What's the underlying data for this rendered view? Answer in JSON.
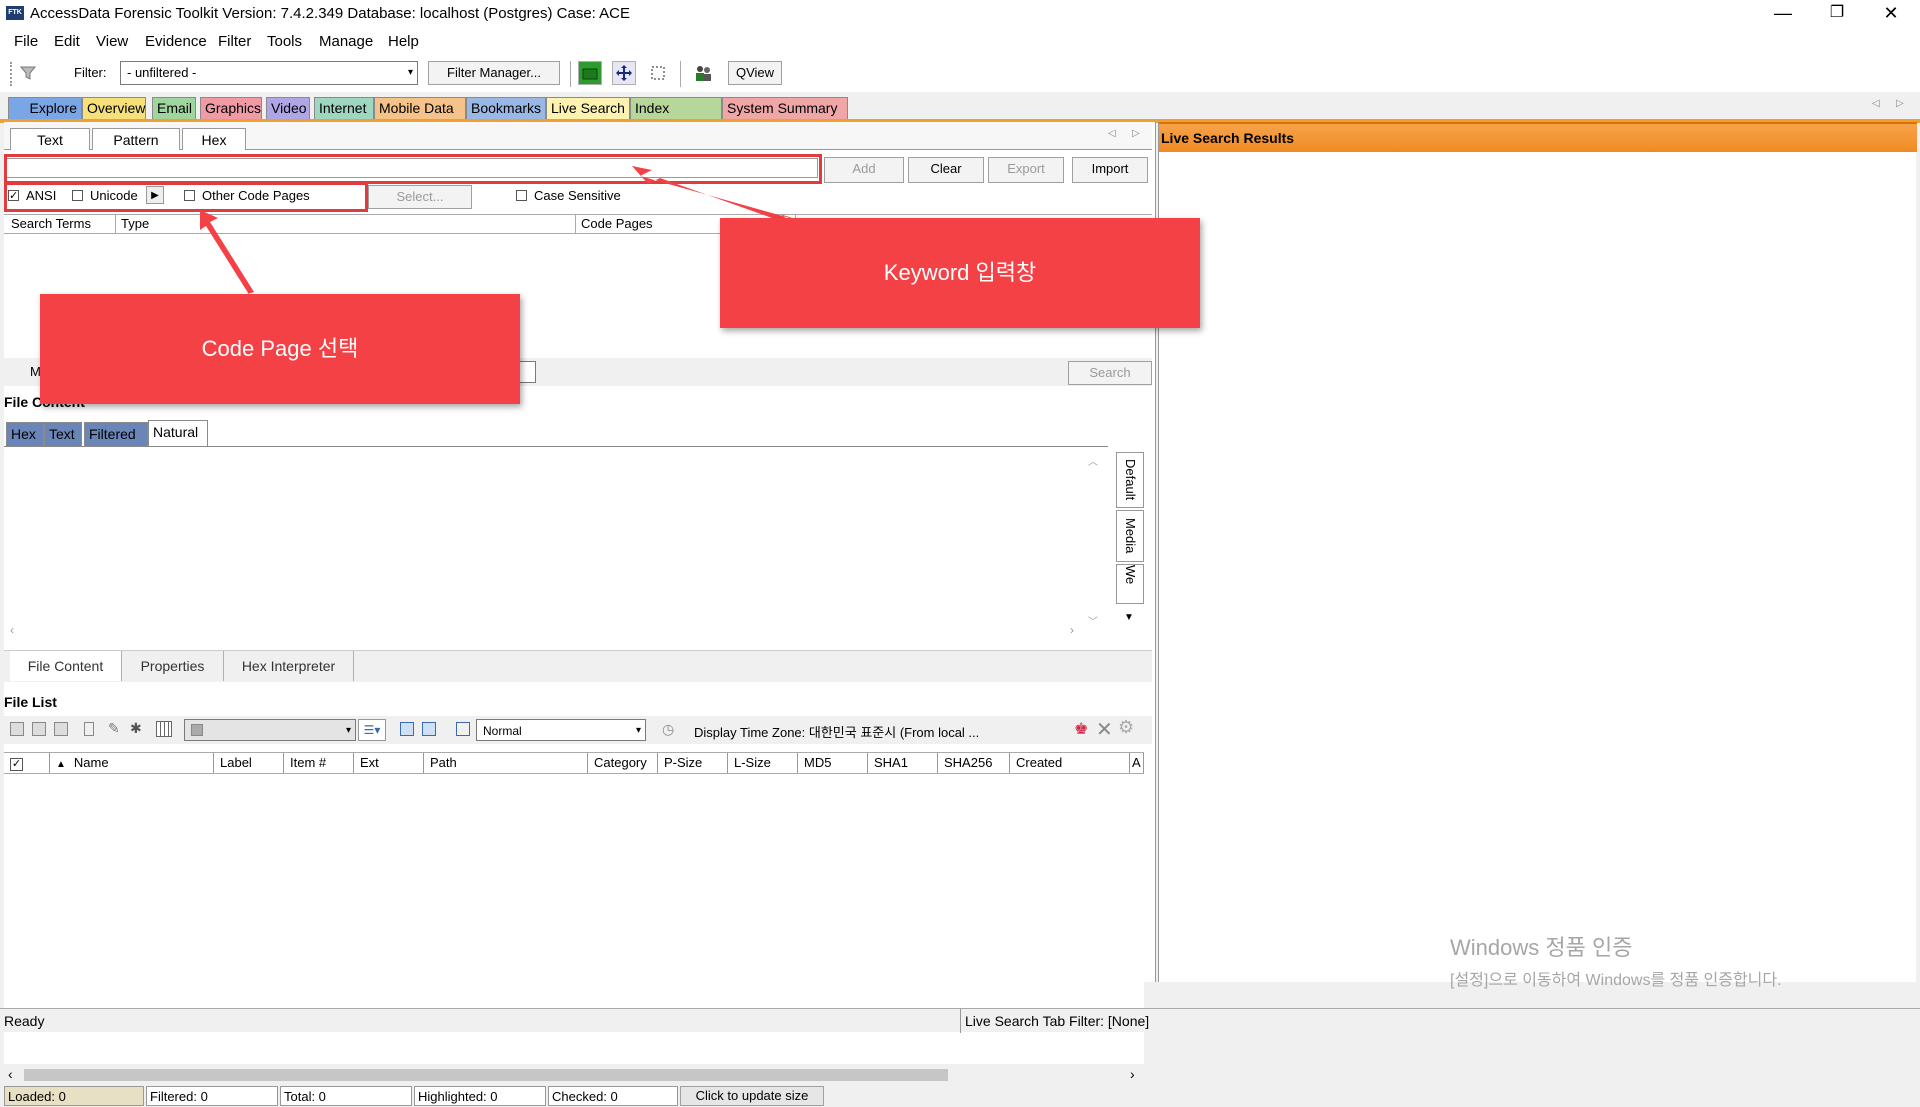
{
  "window": {
    "app_icon_text": "FTK",
    "title": "AccessData Forensic Toolkit Version: 7.4.2.349 Database: localhost (Postgres) Case: ACE",
    "minimize": "—",
    "restore": "❐",
    "close": "✕"
  },
  "menu": [
    "File",
    "Edit",
    "View",
    "Evidence",
    "Filter",
    "Tools",
    "Manage",
    "Help"
  ],
  "toolbar": {
    "filter_label": "Filter:",
    "filter_value": "- unfiltered -",
    "filter_manager": "Filter Manager...",
    "qview": "QView"
  },
  "main_tabs": [
    {
      "label": "Explore",
      "color": "#7aa6e6"
    },
    {
      "label": "Overview",
      "color": "#f5e07a"
    },
    {
      "label": "Email",
      "color": "#9fd69f"
    },
    {
      "label": "Graphics",
      "color": "#f09aa6"
    },
    {
      "label": "Video",
      "color": "#b0a6e6"
    },
    {
      "label": "Internet",
      "color": "#9fd6c0"
    },
    {
      "label": "Mobile Data",
      "color": "#f5c28a"
    },
    {
      "label": "Bookmarks",
      "color": "#9ab8e6"
    },
    {
      "label": "Live Search",
      "color": "#f5e07a"
    },
    {
      "label": "Index Search",
      "color": "#b6d69a"
    },
    {
      "label": "System Summary",
      "color": "#f0a6a6"
    }
  ],
  "search_panel": {
    "tabs": [
      "Text",
      "Pattern",
      "Hex"
    ],
    "keyword_value": "",
    "buttons": {
      "add": "Add",
      "clear": "Clear",
      "export": "Export",
      "import": "Import",
      "select": "Select...",
      "search": "Search"
    },
    "options": {
      "ansi": "ANSI",
      "unicode": "Unicode",
      "other_code_pages": "Other Code Pages",
      "case_sensitive": "Case Sensitive"
    },
    "columns": [
      "Search Terms",
      "Type",
      "Code Pages"
    ],
    "partial_label": "M"
  },
  "file_content": {
    "title": "File Content",
    "view_tabs": [
      "Hex",
      "Text",
      "Filtered",
      "Natural"
    ],
    "side_tabs": [
      "Default",
      "Media",
      "We"
    ],
    "bottom_tabs": [
      "File Content",
      "Properties",
      "Hex Interpreter"
    ]
  },
  "file_list": {
    "title": "File List",
    "view_mode": "Normal",
    "timezone": "Display Time Zone: 대한민국 표준시  (From local ...",
    "columns": [
      "Name",
      "Label",
      "Item #",
      "Ext",
      "Path",
      "Category",
      "P-Size",
      "L-Size",
      "MD5",
      "SHA1",
      "SHA256",
      "Created",
      "A"
    ],
    "status": {
      "loaded": "Loaded: 0",
      "filtered": "Filtered: 0",
      "total": "Total: 0",
      "highlighted": "Highlighted: 0",
      "checked": "Checked: 0",
      "update": "Click to update size"
    }
  },
  "right_panel": {
    "title": "Live Search Results"
  },
  "callouts": {
    "keyword": "Keyword 입력창",
    "codepage": "Code Page 선택"
  },
  "watermark": {
    "line1": "Windows 정품 인증",
    "line2": "[설정]으로 이동하여 Windows를 정품 인증합니다."
  },
  "statusbar": {
    "left": "Ready",
    "right": "Live Search Tab Filter: [None]"
  },
  "colors": {
    "accent_orange": "#f08a24",
    "callout_red": "#f44146"
  }
}
